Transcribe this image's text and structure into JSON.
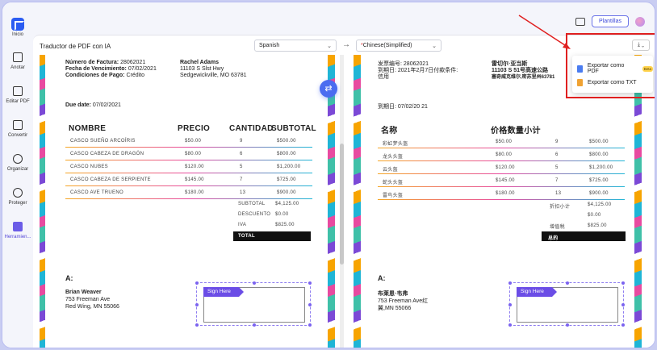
{
  "sidebar": {
    "items": [
      {
        "label": "Inicio"
      },
      {
        "label": "Anotar"
      },
      {
        "label": "Editar PDF"
      },
      {
        "label": "Convertir"
      },
      {
        "label": "Organizar"
      },
      {
        "label": "Proteger"
      },
      {
        "label": "Herramien..."
      }
    ]
  },
  "topbar": {
    "plantillas_label": "Plantillas"
  },
  "panel": {
    "title": "Traductor de PDF con IA",
    "source_lang": "Spanish",
    "target_lang_mark": "*",
    "target_lang": "Chinese(Simplified)",
    "arrow": "→",
    "download_label": "⤓ ⌄"
  },
  "export_menu": {
    "items": [
      {
        "label": "Exportar como PDF",
        "badge": "Beta"
      },
      {
        "label": "Exportar como TXT"
      }
    ]
  },
  "left_doc": {
    "invoice_no_label": "Número de Factura:",
    "invoice_no": "28062021",
    "due_label_top": "Fecha de Vencimiento:",
    "due_top": "07/02/2021",
    "terms_label": "Condiciones de Pago:",
    "terms": "Crédito",
    "client_name": "Rachel Adams",
    "client_addr1": "11103 S Slst Hwy",
    "client_addr2": "Sedgewickville, MO 63781",
    "due_label": "Due date:",
    "due": "07/02/2021",
    "headers": [
      "NOMBRE",
      "PRECIO",
      "CANTIDAD",
      "SUBTOTAL"
    ],
    "rows": [
      {
        "name": "CASCO SUEÑO ARCOÍRIS",
        "price": "$50.00",
        "qty": "9",
        "subtotal": "$500.00"
      },
      {
        "name": "CASCO CABEZA DE DRAGÓN",
        "price": "$80.00",
        "qty": "6",
        "subtotal": "$800.00"
      },
      {
        "name": "CASCO NUBES",
        "price": "$120.00",
        "qty": "5",
        "subtotal": "$1,200.00"
      },
      {
        "name": "CASCO CABEZA DE SERPIENTE",
        "price": "$145.00",
        "qty": "7",
        "subtotal": "$725.00"
      },
      {
        "name": "CASCO AVE TRUENO",
        "price": "$180.00",
        "qty": "13",
        "subtotal": "$900.00"
      }
    ],
    "subtotal_label": "SUBTOTAL",
    "subtotal": "$4,125.00",
    "discount_label": "DESCUENTO",
    "discount": "$0.00",
    "iva_label": "IVA",
    "iva": "$825.00",
    "total_label": "TOTAL",
    "to_label": "A:",
    "to_name": "Brian Weaver",
    "to_addr1": "753 Freeman Ave",
    "to_addr2": "Red Wing, MN 55066",
    "sign_label": "Sign Here"
  },
  "right_doc": {
    "invoice_no_label": "发票编号:",
    "invoice_no": "28062021",
    "due_top_line": "到期日: 2021年2月7日付款条件:",
    "terms": "信用",
    "client_name": "雷切尔·亚当斯",
    "client_addr1": "11103 S 51号高速公路",
    "client_addr2": "塞奇威克维尔,密苏里州63781",
    "due_line": "到期日: 07/02/20 21",
    "headers": [
      "名称",
      "价格数量小计"
    ],
    "rows": [
      {
        "name": "彩虹梦头盔",
        "price": "$50.00",
        "qty": "9",
        "subtotal": "$500.00"
      },
      {
        "name": "龙头头盔",
        "price": "$80.00",
        "qty": "6",
        "subtotal": "$800.00"
      },
      {
        "name": "云头盔",
        "price": "$120.00",
        "qty": "5",
        "subtotal": "$1,200.00"
      },
      {
        "name": "蛇头头盔",
        "price": "$145.00",
        "qty": "7",
        "subtotal": "$725.00"
      },
      {
        "name": "雷鸟头盔",
        "price": "$180.00",
        "qty": "13",
        "subtotal": "$900.00"
      }
    ],
    "subtotal_label": "折扣小计",
    "subtotal": "$4,125.00",
    "discount": "$0.00",
    "iva_label": "增值税",
    "iva": "$825.00",
    "total_label": "总的",
    "to_label": "A:",
    "to_name": "布莱恩·韦弗",
    "to_addr1": "753 Freeman Ave红",
    "to_addr2": "翼,MN 55066",
    "sign_label": "Sign Here"
  },
  "colors": {
    "accent": "#2b5cf2",
    "highlight": "#e02020",
    "sign": "#6b4de6"
  }
}
